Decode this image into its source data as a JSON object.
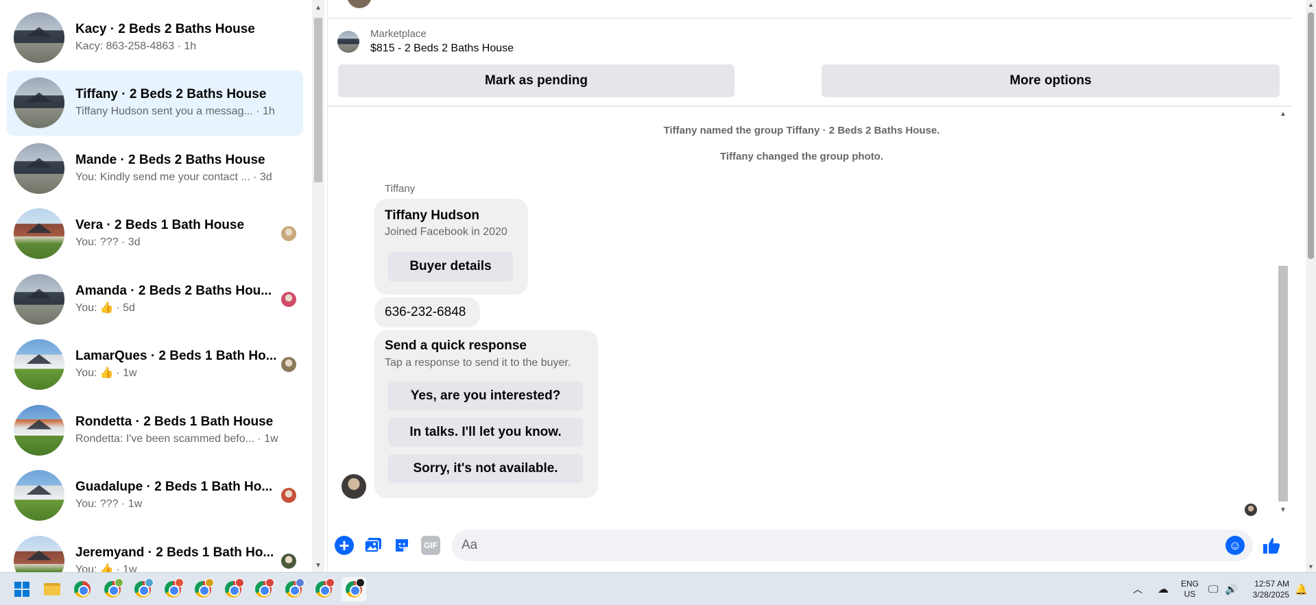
{
  "conversations": [
    {
      "title": "Kacy · 2 Beds 2 Baths House",
      "preview": "Kacy: 863-258-4863 · 1h",
      "thumb": "dark",
      "seen_color": "",
      "active": false
    },
    {
      "title": "Tiffany · 2 Beds 2 Baths House",
      "preview": "Tiffany Hudson sent you a messag... · 1h",
      "thumb": "dark",
      "seen_color": "",
      "active": true
    },
    {
      "title": "Mande · 2 Beds 2 Baths House",
      "preview": "You: Kindly send me your contact ... · 3d",
      "thumb": "dark",
      "seen_color": "",
      "active": false
    },
    {
      "title": "Vera · 2 Beds 1 Bath House",
      "preview": "You: ??? · 3d",
      "thumb": "brick",
      "seen_color": "#c9a87c",
      "active": false
    },
    {
      "title": "Amanda · 2 Beds 2 Baths Hou...",
      "preview_prefix": "You:",
      "preview_suffix": "· 5d",
      "like": true,
      "thumb": "dark",
      "seen_color": "#d04a6a",
      "active": false
    },
    {
      "title": "LamarQues · 2 Beds 1 Bath Ho...",
      "preview_prefix": "You:",
      "preview_suffix": "· 1w",
      "like": true,
      "thumb": "white",
      "seen_color": "#8a7a5a",
      "active": false
    },
    {
      "title": "Rondetta · 2 Beds 1 Bath House",
      "preview": "Rondetta: I've been scammed befo... · 1w",
      "thumb": "autumn",
      "seen_color": "",
      "active": false
    },
    {
      "title": "Guadalupe · 2 Beds 1 Bath Ho...",
      "preview": "You: ??? · 1w",
      "thumb": "white",
      "seen_color": "#c8503a",
      "active": false
    },
    {
      "title": "Jeremyand · 2 Beds 1 Bath Ho...",
      "preview_prefix": "You:",
      "preview_suffix": "· 1w",
      "like": true,
      "thumb": "brick",
      "seen_color": "#4a5a3a",
      "active": false
    }
  ],
  "listing": {
    "source": "Marketplace",
    "price_title": "$815 - 2 Beds 2 Baths House",
    "mark_pending": "Mark as pending",
    "more_options": "More options"
  },
  "thread": {
    "system_messages": [
      "Tiffany named the group Tiffany · 2 Beds 2 Baths House.",
      "Tiffany changed the group photo."
    ],
    "sender": "Tiffany",
    "buyer_card": {
      "name": "Tiffany Hudson",
      "joined": "Joined Facebook in 2020",
      "button": "Buyer details"
    },
    "phone": "636-232-6848",
    "quick_response": {
      "title": "Send a quick response",
      "subtitle": "Tap a response to send it to the buyer.",
      "options": [
        "Yes, are you interested?",
        "In talks. I'll let you know.",
        "Sorry, it's not available."
      ]
    }
  },
  "composer": {
    "placeholder": "Aa",
    "gif_label": "GIF",
    "icons": [
      "plus-icon",
      "photo-icon",
      "sticker-icon",
      "gif-icon",
      "emoji-icon",
      "like-icon"
    ]
  },
  "taskbar": {
    "language_top": "ENG",
    "language_bottom": "US",
    "time": "12:57 AM",
    "date": "3/28/2025",
    "chrome_badge_colors": [
      "#a06cd5",
      "#7cb342",
      "#4fa3d1",
      "#e0553a",
      "#d4a017",
      "#d6453a",
      "#d6453a",
      "#5b7fd6",
      "#d6453a",
      "#1b1b1b"
    ]
  },
  "colors": {
    "accent": "#0866ff",
    "active_conversation": "#e7f3ff",
    "button_gray": "#e4e6eb",
    "bubble_gray": "#f0f0f0"
  }
}
